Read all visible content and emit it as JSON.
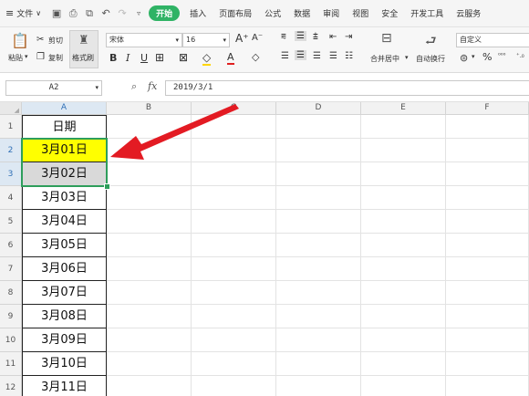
{
  "menubar": {
    "file_label": "文件",
    "tabs": [
      "插入",
      "页面布局",
      "公式",
      "数据",
      "审阅",
      "视图",
      "安全",
      "开发工具",
      "云服务"
    ],
    "active_tab": "开始"
  },
  "ribbon": {
    "paste": "粘贴",
    "cut": "剪切",
    "copy": "复制",
    "format_painter": "格式刷",
    "font_name": "宋体",
    "font_size": "16",
    "merge_center": "合并居中",
    "wrap_text": "自动换行",
    "number_format": "自定义",
    "percent": "%"
  },
  "formula_bar": {
    "name_box": "A2",
    "fx": "fx",
    "value": "2019/3/1"
  },
  "sheet": {
    "columns": [
      "A",
      "B",
      "C",
      "D",
      "E",
      "F"
    ],
    "rows": [
      "1",
      "2",
      "3",
      "4",
      "5",
      "6",
      "7",
      "8",
      "9",
      "10",
      "11",
      "12"
    ],
    "cells": [
      "日期",
      "3月01日",
      "3月02日",
      "3月03日",
      "3月04日",
      "3月05日",
      "3月06日",
      "3月07日",
      "3月08日",
      "3月09日",
      "3月10日",
      "3月11日"
    ],
    "highlight_color": "#ffff00",
    "selection_color": "#2e9e5b",
    "arrow_color": "#e31b23"
  }
}
